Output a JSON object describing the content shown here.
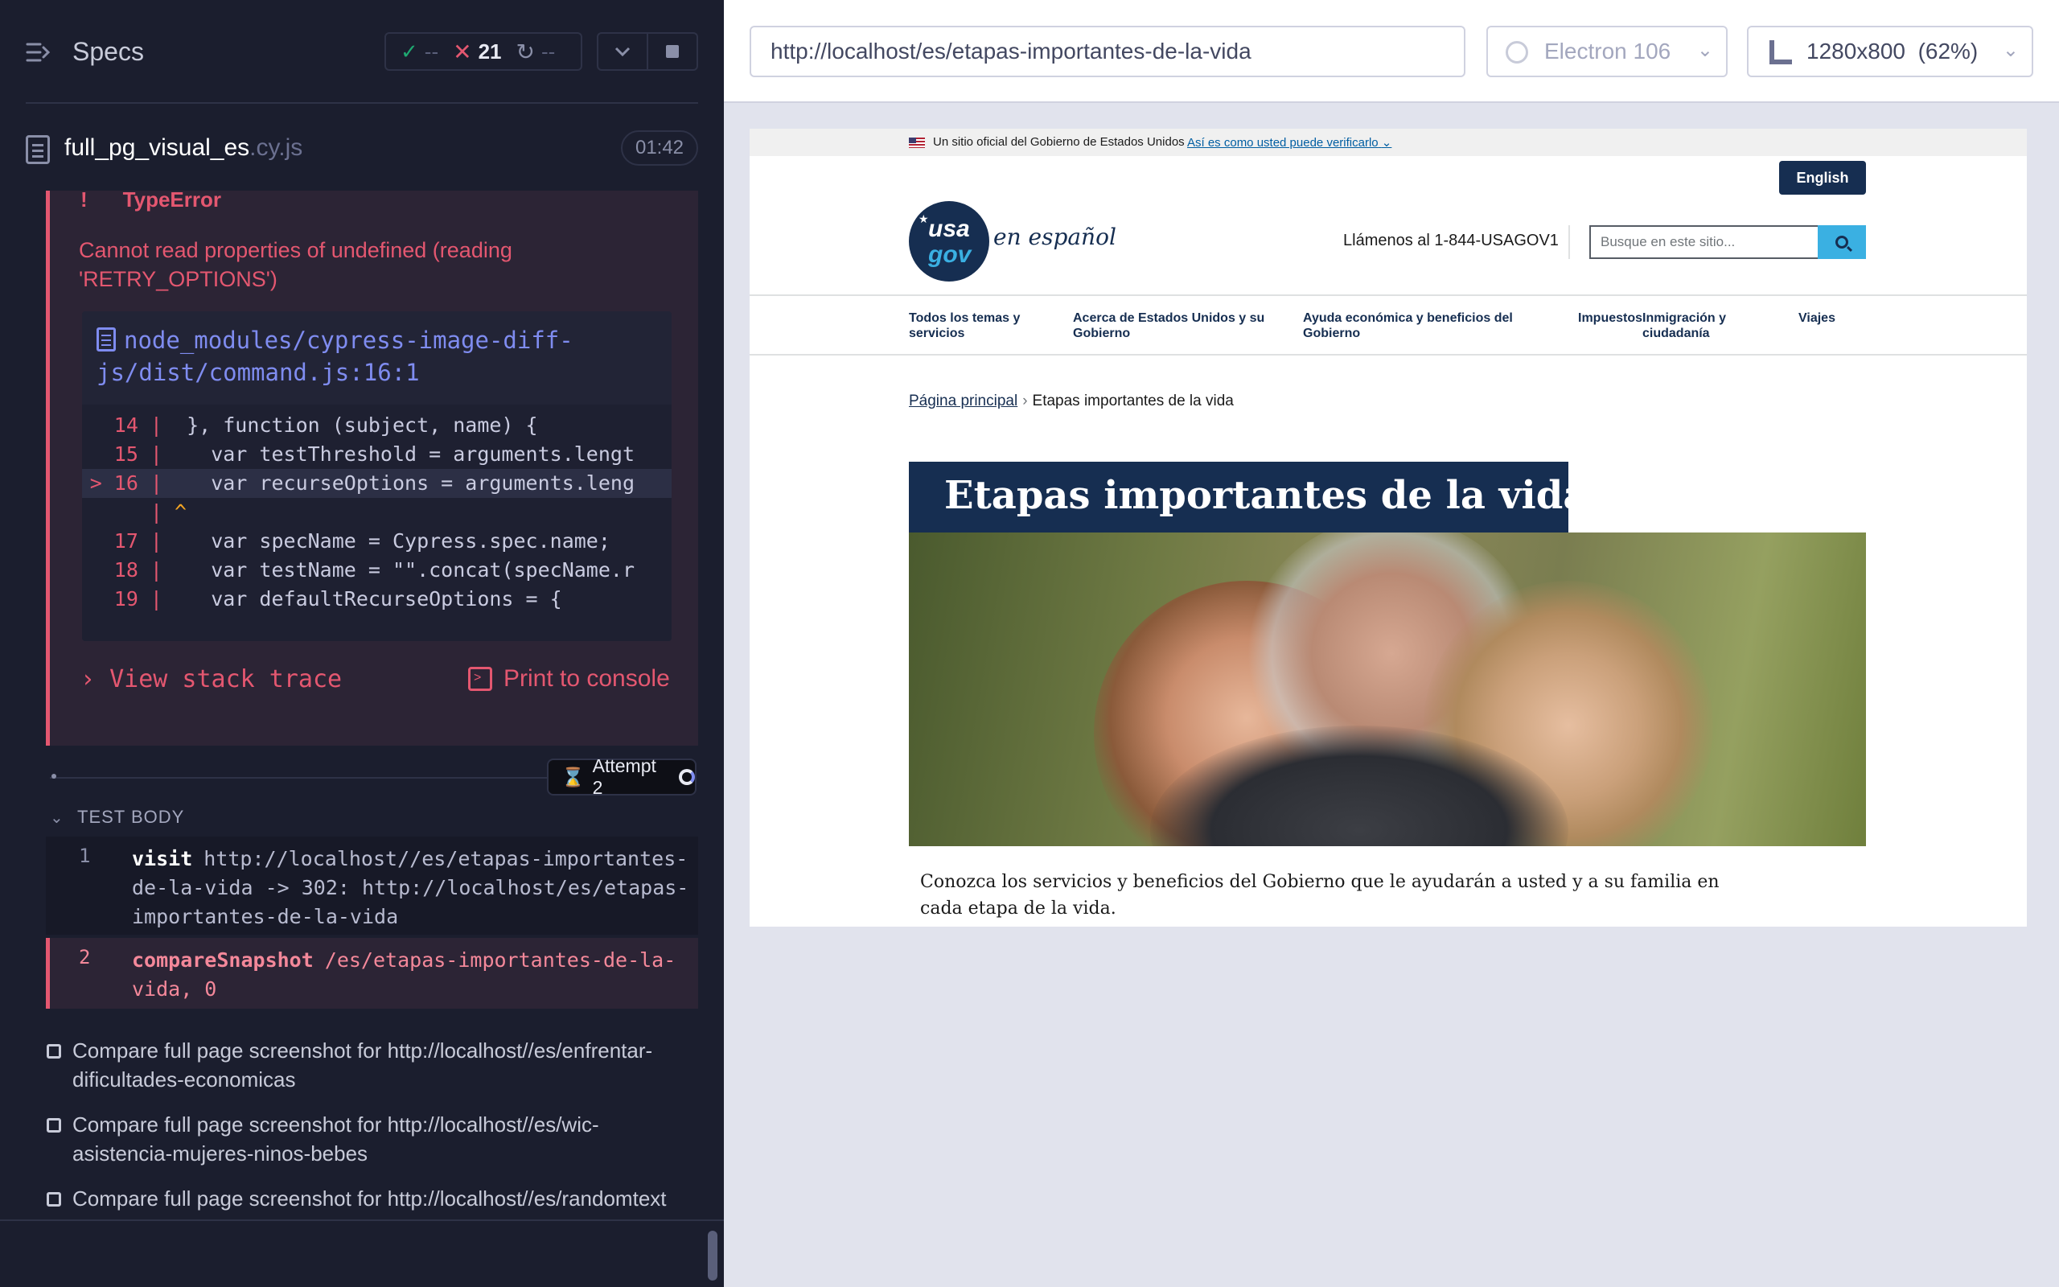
{
  "reporter": {
    "title": "Specs",
    "stats": {
      "passed": "--",
      "failed": "21",
      "pending": "--"
    },
    "spec_file": {
      "name": "full_pg_visual_es",
      "ext": ".cy.js",
      "duration": "01:42"
    },
    "error": {
      "type": "TypeError",
      "message": "Cannot read properties of undefined (reading 'RETRY_OPTIONS')",
      "file_path": "node_modules/cypress-image-diff-js/dist/command.js:16:1",
      "code_lines": [
        {
          "gutter": "14 |",
          "code": "  }, function (subject, name) {"
        },
        {
          "gutter": "15 |",
          "code": "    var testThreshold = arguments.lengt"
        },
        {
          "gutter": "> 16 |",
          "code": "    var recurseOptions = arguments.leng"
        },
        {
          "gutter": "|",
          "code": " ^"
        },
        {
          "gutter": "17 |",
          "code": "    var specName = Cypress.spec.name;"
        },
        {
          "gutter": "18 |",
          "code": "    var testName = \"\".concat(specName.r"
        },
        {
          "gutter": "19 |",
          "code": "    var defaultRecurseOptions = {"
        }
      ],
      "view_stack_label": "View stack trace",
      "print_console_label": "Print to console"
    },
    "attempt_label": "Attempt 2",
    "test_body_label": "TEST BODY",
    "commands": [
      {
        "num": "1",
        "name": "visit",
        "arg": "http://localhost//es/etapas-importantes-de-la-vida -> 302: http://localhost/es/etapas-importantes-de-la-vida"
      },
      {
        "num": "2",
        "name": "compareSnapshot",
        "arg": "/es/etapas-importantes-de-la-vida, 0"
      }
    ],
    "pending_tests": [
      "Compare full page screenshot for http://localhost//es/enfrentar-dificultades-economicas",
      "Compare full page screenshot for http://localhost//es/wic-asistencia-mujeres-ninos-bebes",
      "Compare full page screenshot for http://localhost//es/randomtext"
    ]
  },
  "aut": {
    "url": "http://localhost/es/etapas-importantes-de-la-vida",
    "browser": "Electron 106",
    "viewport": "1280x800  (62%)"
  },
  "page": {
    "gov_banner_text": "Un sitio oficial del Gobierno de Estados Unidos",
    "gov_banner_link": "Así es como usted puede verificarlo",
    "lang_button": "English",
    "logo_usa": "usa",
    "logo_gov": "gov",
    "logo_espanol": "en español",
    "phone": "Llámenos al 1-844-USAGOV1",
    "search_placeholder": "Busque en este sitio...",
    "nav": [
      "Todos los temas y servicios",
      "Acerca de Estados Unidos y su Gobierno",
      "Ayuda económica y beneficios del Gobierno",
      "Impuestos",
      "Inmigración y ciudadanía",
      "Viajes"
    ],
    "breadcrumb_home": "Página principal",
    "breadcrumb_current": "Etapas importantes de la vida",
    "hero_title": "Etapas importantes de la vida",
    "description": "Conozca los servicios y beneficios del Gobierno que le ayudarán a usted y a su familia en cada etapa de la vida."
  }
}
